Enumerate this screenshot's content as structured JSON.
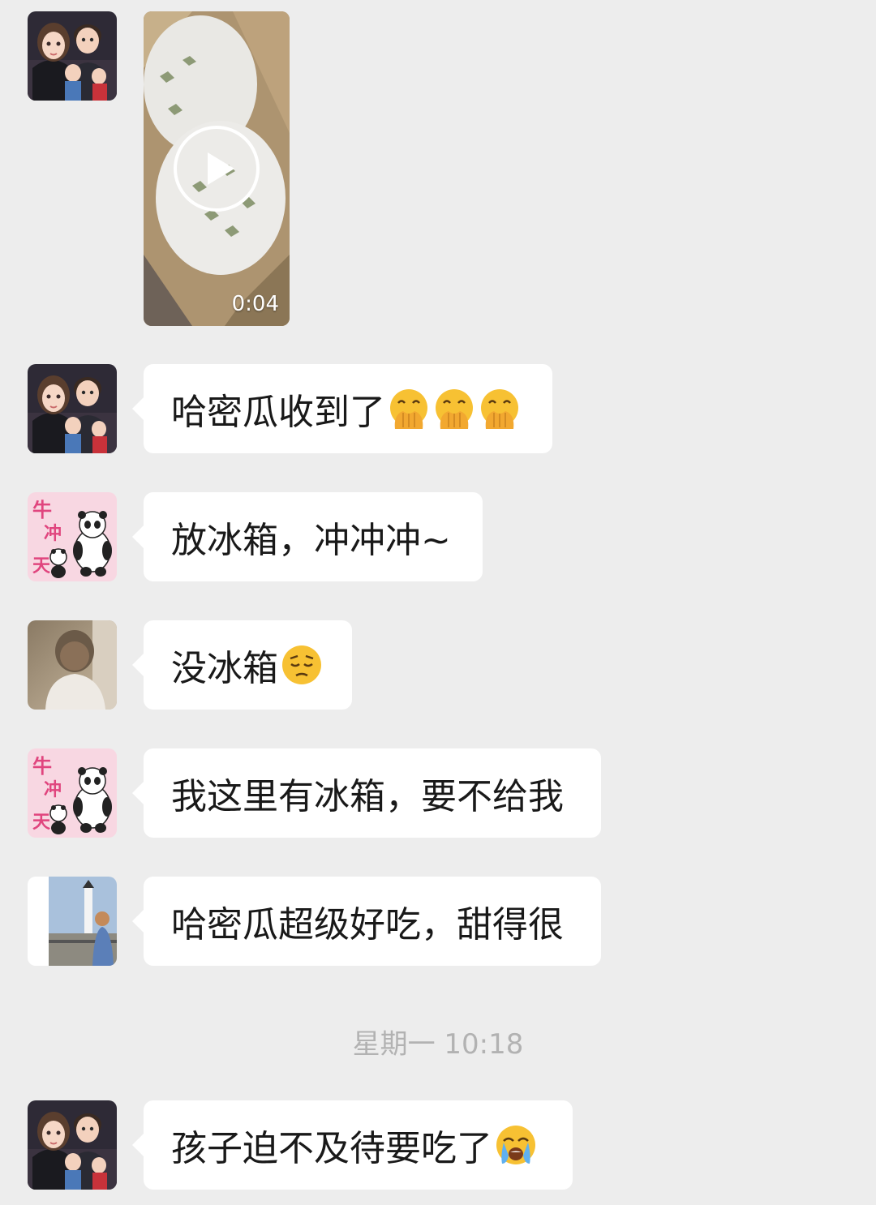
{
  "colors": {
    "background": "#ededed",
    "bubble": "#ffffff",
    "text": "#191919",
    "timestamp": "#b2b2b2"
  },
  "video": {
    "duration": "0:04",
    "icon": "play-icon"
  },
  "messages": [
    {
      "avatar": "family-cartoon-avatar",
      "text": "哈密瓜收到了",
      "emoji": [
        "hand-over-mouth-emoji",
        "hand-over-mouth-emoji",
        "hand-over-mouth-emoji"
      ]
    },
    {
      "avatar": "panda-niu-avatar",
      "text": "放冰箱，冲冲冲~",
      "emoji": []
    },
    {
      "avatar": "child-photo-avatar",
      "text": "没冰箱",
      "emoji": [
        "pensive-face-emoji"
      ]
    },
    {
      "avatar": "panda-niu-avatar",
      "text": "我这里有冰箱，要不给我",
      "emoji": []
    },
    {
      "avatar": "lighthouse-photo-avatar",
      "text": "哈密瓜超级好吃，甜得很",
      "emoji": []
    }
  ],
  "divider": {
    "timestamp": "星期一 10:18"
  },
  "after_divider": [
    {
      "avatar": "family-cartoon-avatar",
      "text": "孩子迫不及待要吃了",
      "emoji": [
        "loudly-crying-face-emoji"
      ]
    }
  ]
}
